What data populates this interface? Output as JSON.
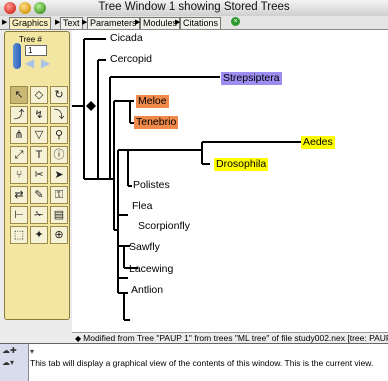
{
  "window": {
    "title": "Tree Window 1 showing Stored Trees"
  },
  "tabs": [
    {
      "label": "Graphics",
      "active": true
    },
    {
      "label": "Text",
      "active": false
    },
    {
      "label": "Parameters",
      "active": false
    },
    {
      "label": "Modules",
      "active": false
    },
    {
      "label": "Citations",
      "active": false
    }
  ],
  "tool_panel": {
    "tree_label": "Tree #",
    "tree_value": "1",
    "tools": [
      "arrow-tool",
      "node-tool",
      "swap-tool",
      "reroot-tool",
      "move-branch-tool",
      "collapse-tool",
      "taxa-tool",
      "ladderize-tool",
      "magnify-tool",
      "scale-tool",
      "label-tool",
      "info-tool",
      "branch-tool",
      "prune-tool",
      "pointer-tool",
      "interchange-tool",
      "paint-tool",
      "lock-tool",
      "measure-tool",
      "cut-tool",
      "ruler-tool"
    ]
  },
  "tree": {
    "taxa": [
      {
        "name": "Cicada",
        "highlight": null
      },
      {
        "name": "Cercopid",
        "highlight": null
      },
      {
        "name": "Strepsiptera",
        "highlight": "#9c8ef0"
      },
      {
        "name": "Meloe",
        "highlight": "#f08a4a"
      },
      {
        "name": "Tenebrio",
        "highlight": "#f08a4a"
      },
      {
        "name": "Aedes",
        "highlight": "#ffff00"
      },
      {
        "name": "Drosophila",
        "highlight": "#ffff00"
      },
      {
        "name": "Polistes",
        "highlight": null
      },
      {
        "name": "Flea",
        "highlight": null
      },
      {
        "name": "Scorpionfly",
        "highlight": null
      },
      {
        "name": "Sawfly",
        "highlight": null
      },
      {
        "name": "Lacewing",
        "highlight": null
      },
      {
        "name": "Antlion",
        "highlight": null
      }
    ]
  },
  "status": {
    "text": "Modified from Tree \"PAUP 1\" from trees \"ML tree\" of file study002.nex  [tree: PAUP"
  },
  "explanation": {
    "text": "This tab will display a graphical view of the contents of this window.  This is the current view."
  },
  "colors": {
    "panel": "#f3e6a3",
    "purple_highlight": "#9c8ef0",
    "orange_highlight": "#f08a4a",
    "yellow_highlight": "#ffff00"
  }
}
